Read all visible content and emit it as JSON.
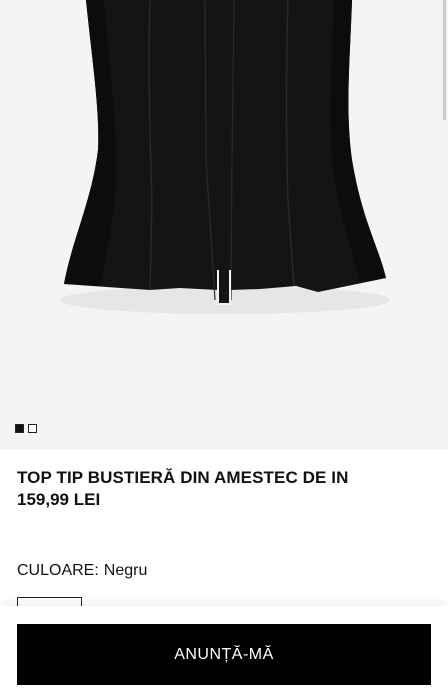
{
  "gallery": {
    "image": "black-bustier-top-photo",
    "slides": 2,
    "active_slide": 1
  },
  "product": {
    "title": "TOP TIP BUSTIERĂ DIN AMESTEC DE IN",
    "price": "159,99 LEI"
  },
  "color": {
    "label": "CULOARE:",
    "value": "Negru"
  },
  "actions": {
    "notify_label": "ANUNȚĂ-MĂ"
  },
  "colors": {
    "background": "#ffffff",
    "image_bg": "#f4f4f4",
    "button": "#000000",
    "text": "#111111"
  }
}
